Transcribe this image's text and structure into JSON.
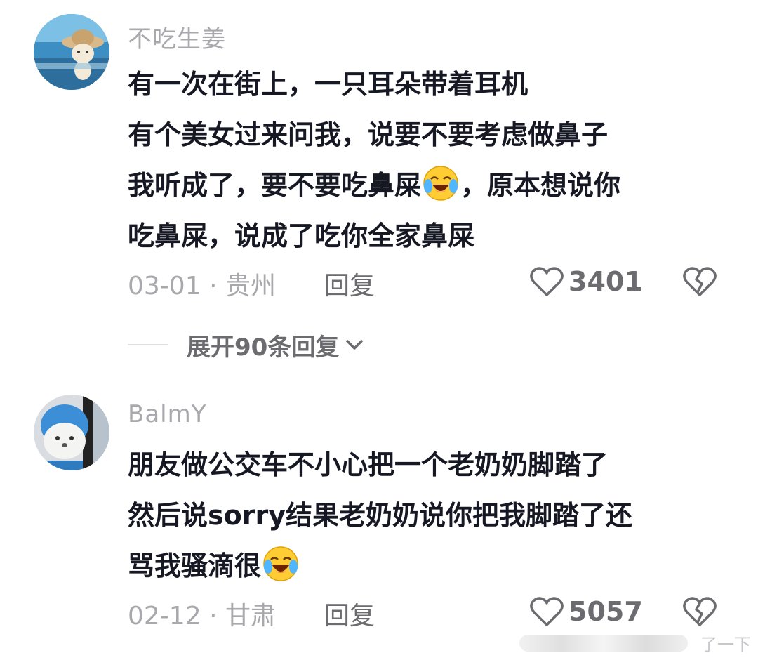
{
  "comments": [
    {
      "username": "不吃生姜",
      "lines": [
        {
          "parts": [
            {
              "t": "有一次在街上，一只耳朵带着耳机"
            }
          ]
        },
        {
          "parts": [
            {
              "t": "有个美女过来问我，说要不要考虑做鼻子"
            }
          ]
        },
        {
          "parts": [
            {
              "t": "我听成了，要不要吃鼻屎"
            },
            {
              "emoji": "crying-laughing"
            },
            {
              "t": "，原本想说你"
            }
          ]
        },
        {
          "parts": [
            {
              "t": "吃鼻屎，说成了吃你全家鼻屎"
            }
          ]
        }
      ],
      "date": "03-01",
      "location": "贵州",
      "reply_label": "回复",
      "likes": "3401"
    },
    {
      "username": "BalmY",
      "lines": [
        {
          "parts": [
            {
              "t": "朋友做公交车不小心把一个老奶奶脚踏了"
            }
          ]
        },
        {
          "parts": [
            {
              "t": "然后说sorry结果老奶奶说你把我脚踏了还"
            }
          ]
        },
        {
          "parts": [
            {
              "t": "骂我骚滴很"
            },
            {
              "emoji": "crying-laughing"
            }
          ]
        }
      ],
      "date": "02-12",
      "location": "甘肃",
      "reply_label": "回复",
      "likes": "5057"
    }
  ],
  "expand_replies": "展开90条回复",
  "watermark": "了一下",
  "colors": {
    "meta": "#a8a8ad",
    "text": "#161823",
    "action": "#6b6b70"
  }
}
